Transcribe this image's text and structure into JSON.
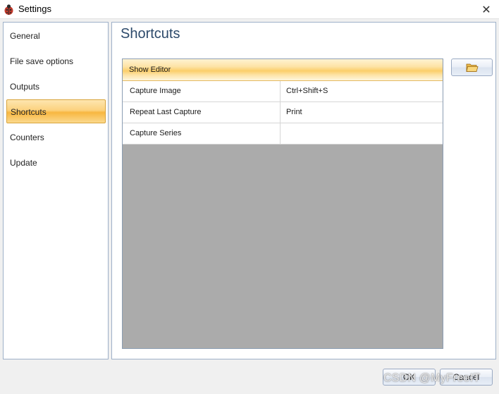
{
  "window": {
    "title": "Settings",
    "close_glyph": "✕",
    "app_icon": "ladybug-icon"
  },
  "sidebar": {
    "items": [
      {
        "label": "General",
        "active": false
      },
      {
        "label": "File save options",
        "active": false
      },
      {
        "label": "Outputs",
        "active": false
      },
      {
        "label": "Shortcuts",
        "active": true
      },
      {
        "label": "Counters",
        "active": false
      },
      {
        "label": "Update",
        "active": false
      }
    ]
  },
  "main": {
    "heading": "Shortcuts",
    "header_row": "Show Editor",
    "rows": [
      {
        "name": "Capture Image",
        "key": "Ctrl+Shift+S"
      },
      {
        "name": "Repeat Last Capture",
        "key": "Print"
      },
      {
        "name": "Capture Series",
        "key": ""
      }
    ],
    "folder_button_icon": "folder-icon"
  },
  "footer": {
    "ok_label": "OK",
    "cancel_label": "Cancel"
  },
  "watermark": "CSDN @MyFreeIT",
  "colors": {
    "accent_orange": "#fbce6a",
    "heading_blue": "#2d4a6b",
    "border_blue": "#9eb0c8",
    "grid_empty": "#ababab"
  }
}
